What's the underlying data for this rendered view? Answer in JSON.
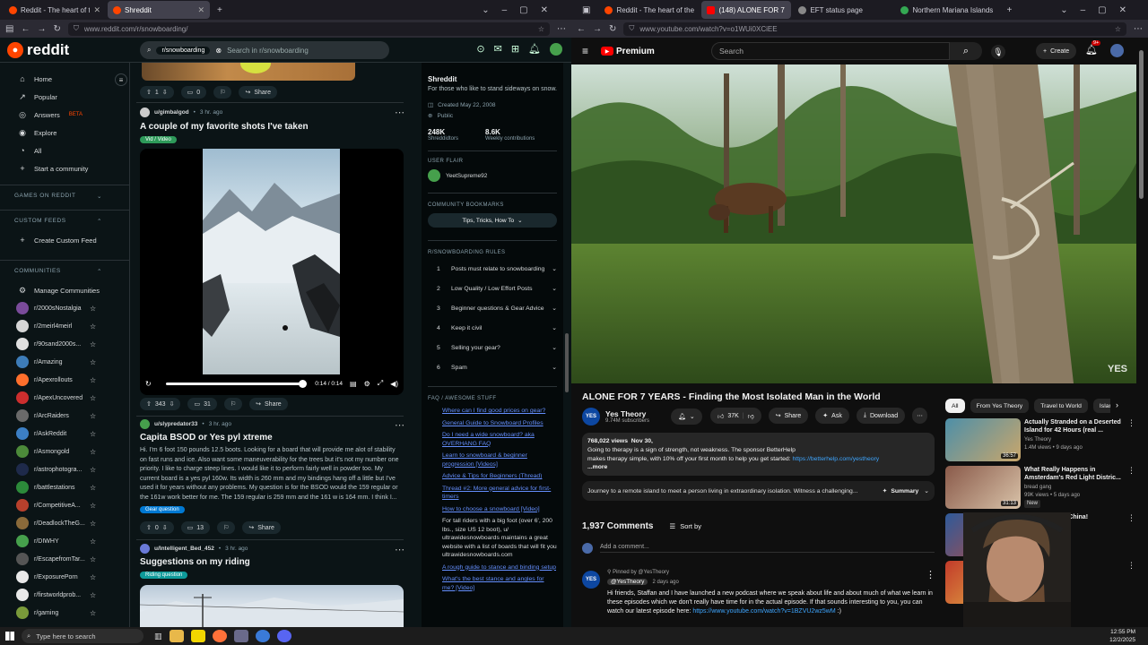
{
  "browser_left": {
    "tabs": [
      {
        "title": "Reddit - The heart of the intern",
        "active": false
      },
      {
        "title": "Shreddit",
        "active": true
      }
    ],
    "url": "www.reddit.com/r/snowboarding/"
  },
  "browser_right": {
    "tabs": [
      {
        "title": "Reddit - The heart of the intern",
        "active": false
      },
      {
        "title": "(148) ALONE FOR 7 YEA",
        "active": true
      },
      {
        "title": "EFT status page",
        "active": false
      },
      {
        "title": "Northern Mariana Islands - Goo",
        "active": false
      }
    ],
    "url": "www.youtube.com/watch?v=o1WUi0XCiEE"
  },
  "reddit": {
    "logo": "reddit",
    "search": {
      "chip": "r/snowboarding",
      "placeholder": "Search in r/snowboarding"
    },
    "nav": [
      {
        "icon": "home-icon",
        "glyph": "⌂",
        "label": "Home"
      },
      {
        "icon": "popular-icon",
        "glyph": "↗",
        "label": "Popular"
      },
      {
        "icon": "answers-icon",
        "glyph": "◎",
        "label": "Answers",
        "badge": "BETA"
      },
      {
        "icon": "explore-icon",
        "glyph": "◉",
        "label": "Explore"
      },
      {
        "icon": "all-icon",
        "glyph": "◔",
        "label": "All"
      },
      {
        "icon": "plus-icon",
        "glyph": "+",
        "label": "Start a community"
      }
    ],
    "sections": {
      "games": "GAMES ON REDDIT",
      "custom_feeds": "CUSTOM FEEDS",
      "create_custom_feed": "Create Custom Feed",
      "communities": "COMMUNITIES",
      "manage": "Manage Communities"
    },
    "communities": [
      {
        "name": "r/2000sNostalgia",
        "color": "#7a4b9a"
      },
      {
        "name": "r/2meirl4meirl",
        "color": "#d6d6d6"
      },
      {
        "name": "r/90sand2000s...",
        "color": "#e0e0e0"
      },
      {
        "name": "r/Amazing",
        "color": "#3d7cb8"
      },
      {
        "name": "r/Apexrollouts",
        "color": "#ff6f2c"
      },
      {
        "name": "r/ApexUncovered",
        "color": "#cc2e2e"
      },
      {
        "name": "r/ArcRaiders",
        "color": "#6a6a6a"
      },
      {
        "name": "r/AskReddit",
        "color": "#3c7fc4"
      },
      {
        "name": "r/Asmongold",
        "color": "#4c8a3a"
      },
      {
        "name": "r/astrophotogra...",
        "color": "#1e2a4a"
      },
      {
        "name": "r/battlestations",
        "color": "#2c8a3a"
      },
      {
        "name": "r/CompetitiveA...",
        "color": "#b8402c"
      },
      {
        "name": "r/DeadlockTheG...",
        "color": "#8a6a3a"
      },
      {
        "name": "r/DIWHY",
        "color": "#46a04c"
      },
      {
        "name": "r/EscapefromTar...",
        "color": "#555555"
      },
      {
        "name": "r/ExposurePorn",
        "color": "#e8e8e8"
      },
      {
        "name": "r/firstworldprob...",
        "color": "#e8e8e8"
      },
      {
        "name": "r/gaming",
        "color": "#7a9a3a"
      }
    ],
    "posts": [
      {
        "actions": {
          "votes": "1",
          "comments": "0",
          "share": "Share"
        }
      },
      {
        "user": "u/gimbalgod",
        "time": "3 hr. ago",
        "title": "A couple of my favorite shots I've taken",
        "flair": "Vid / Video",
        "flair_color": "#2e9a5a",
        "video": {
          "time": "0:14 / 0:14",
          "progress": 1.0
        },
        "actions": {
          "votes": "343",
          "comments": "31",
          "share": "Share"
        }
      },
      {
        "user": "u/slypredator33",
        "time": "3 hr. ago",
        "title": "Capita BSOD or Yes pyl xtreme",
        "body": "Hi. I'm 6 foot 150 pounds 12.5 boots. Looking for a board that will provide me alot of stability on fast runs and ice. Also want some maneuverability for the trees but it's not my number one priority. I like to charge steep lines. I would like it to perform fairly well in powder too. My current board is a yes pyl 160w. Its width is 260 mm and my bindings hang off a little but I've used it for years without any problems. My question is for the BSOD would the 159 regular or the 161w work better for me. The 159 regular is 259 mm and the 161 w is 164 mm. I think I...",
        "flair": "Gear question",
        "flair_color": "#0079d3",
        "actions": {
          "votes": "0",
          "comments": "13",
          "share": "Share"
        }
      },
      {
        "user": "u/Intelligent_Bed_452",
        "time": "3 hr. ago",
        "title": "Suggestions on my riding",
        "flair": "Riding question",
        "flair_color": "#0e9a9a"
      }
    ],
    "sidebar": {
      "title": "Shreddit",
      "desc": "For those who like to stand sideways on snow.",
      "created": "Created May 22, 2008",
      "visibility": "Public",
      "members": "248K",
      "members_label": "Shreddidtors",
      "weekly": "8.6K",
      "weekly_label": "Weekly contributions",
      "user_flair_head": "USER FLAIR",
      "user_flair": "YeetSupreme92",
      "bookmarks_head": "COMMUNITY BOOKMARKS",
      "bookmark_button": "Tips, Tricks, How To",
      "rules_head": "R/SNOWBOARDING RULES",
      "rules": [
        {
          "n": "1",
          "t": "Posts must relate to snowboarding"
        },
        {
          "n": "2",
          "t": "Low Quality / Low Effort Posts"
        },
        {
          "n": "3",
          "t": "Beginner questions & Gear Advice"
        },
        {
          "n": "4",
          "t": "Keep it civil"
        },
        {
          "n": "5",
          "t": "Selling your gear?"
        },
        {
          "n": "6",
          "t": "Spam"
        }
      ],
      "faq_head": "FAQ / AWESOME STUFF",
      "faq": [
        {
          "t": "Where can I find good prices on gear?",
          "link": true
        },
        {
          "t": "General Guide to Snowboard Profiles",
          "link": true
        },
        {
          "t": "Do I need a wide snowboard? aka OVERHANG FAQ",
          "link": true
        },
        {
          "t": "Learn to snowboard & beginner progression [Videos]",
          "link": true
        },
        {
          "t": "Advice & Tips for Beginners (Thread)",
          "link": true
        },
        {
          "t": "Thread #2: More general advice for first-timers",
          "link": true
        },
        {
          "t": "How to choose a snowboard [Video]",
          "link": true
        },
        {
          "t": "For tall riders with a big foot (over 6', 200 lbs., size US 12 boot), u/ ultrawidesnowboards maintains a great website with a list of boards that will fit you ultrawidesnowboards.com",
          "link": false
        },
        {
          "t": "A rough guide to stance and binding setup",
          "link": true
        },
        {
          "t": "What's the best stance and angles for me? [Video]",
          "link": true
        }
      ]
    }
  },
  "youtube": {
    "logo": "Premium",
    "search_placeholder": "Search",
    "create": "Create",
    "notif_count": "9+",
    "watermark": "YES",
    "title": "ALONE FOR 7 YEARS - Finding the Most Isolated Man in the World",
    "channel": {
      "name": "Yes Theory",
      "subs": "9.74M subscribers",
      "initials": "YES"
    },
    "actions": {
      "likes": "37K",
      "share": "Share",
      "ask": "Ask",
      "download": "Download"
    },
    "description": {
      "views": "768,022 views",
      "date": "Nov 30,",
      "line1": "Going to therapy is a sign of strength, not weakness. The sponsor BetterHelp",
      "line2": "makes therapy simple, with 10% off your first month to help you get started:",
      "link": "https://betterhelp.com/yestheory",
      "more": "...more"
    },
    "summary": {
      "text": "Journey to a remote island to meet a person living in extraordinary isolation. Witness a challenging...",
      "label": "Summary"
    },
    "comments": {
      "count": "1,937 Comments",
      "sort": "Sort by",
      "add": "Add a comment...",
      "pinned": "Pinned by @YesTheory",
      "author": "@YesTheory",
      "time": "2 days ago",
      "text": "Hi friends, Staffan and I have launched a new podcast where we speak about life and about much of what we learn in these episodes which we don't really have time for in the actual episode. If that sounds interesting to you, you can watch our latest episode here:",
      "link": "https://www.youtube.com/watch?v=1BZVU2wz5wM",
      "tail": ":)"
    },
    "chips": [
      "All",
      "From Yes Theory",
      "Travel to World",
      "Islands"
    ],
    "recommendations": [
      {
        "title": "Actually Stranded on a Deserted Island for 42 Hours (real ...",
        "channel": "Yes Theory",
        "meta": "1.4M views • 9 days ago",
        "dur": "36:57",
        "c1": "#4d8fa8",
        "c2": "#c9a66b"
      },
      {
        "title": "What Really Happens in Amsterdam's Red Light Distric...",
        "channel": "bread gang",
        "meta": "99K views • 5 days ago",
        "badge": "New",
        "dur": "31:13",
        "c1": "#8a5a4a",
        "c2": "#d8c2a8"
      },
      {
        "title": "FULL SEND In China!",
        "channel": "",
        "meta": "days ago",
        "dur": "",
        "c1": "#2e5a9a",
        "c2": "#c24a3a"
      },
      {
        "title": "America's ...",
        "channel": "Ft. Bam, ...",
        "meta": "",
        "dur": "",
        "c1": "#c23a2a",
        "c2": "#e8c24a"
      }
    ]
  },
  "taskbar": {
    "search": "Type here to search",
    "time": "12:55 PM",
    "date": "12/2/2025"
  }
}
